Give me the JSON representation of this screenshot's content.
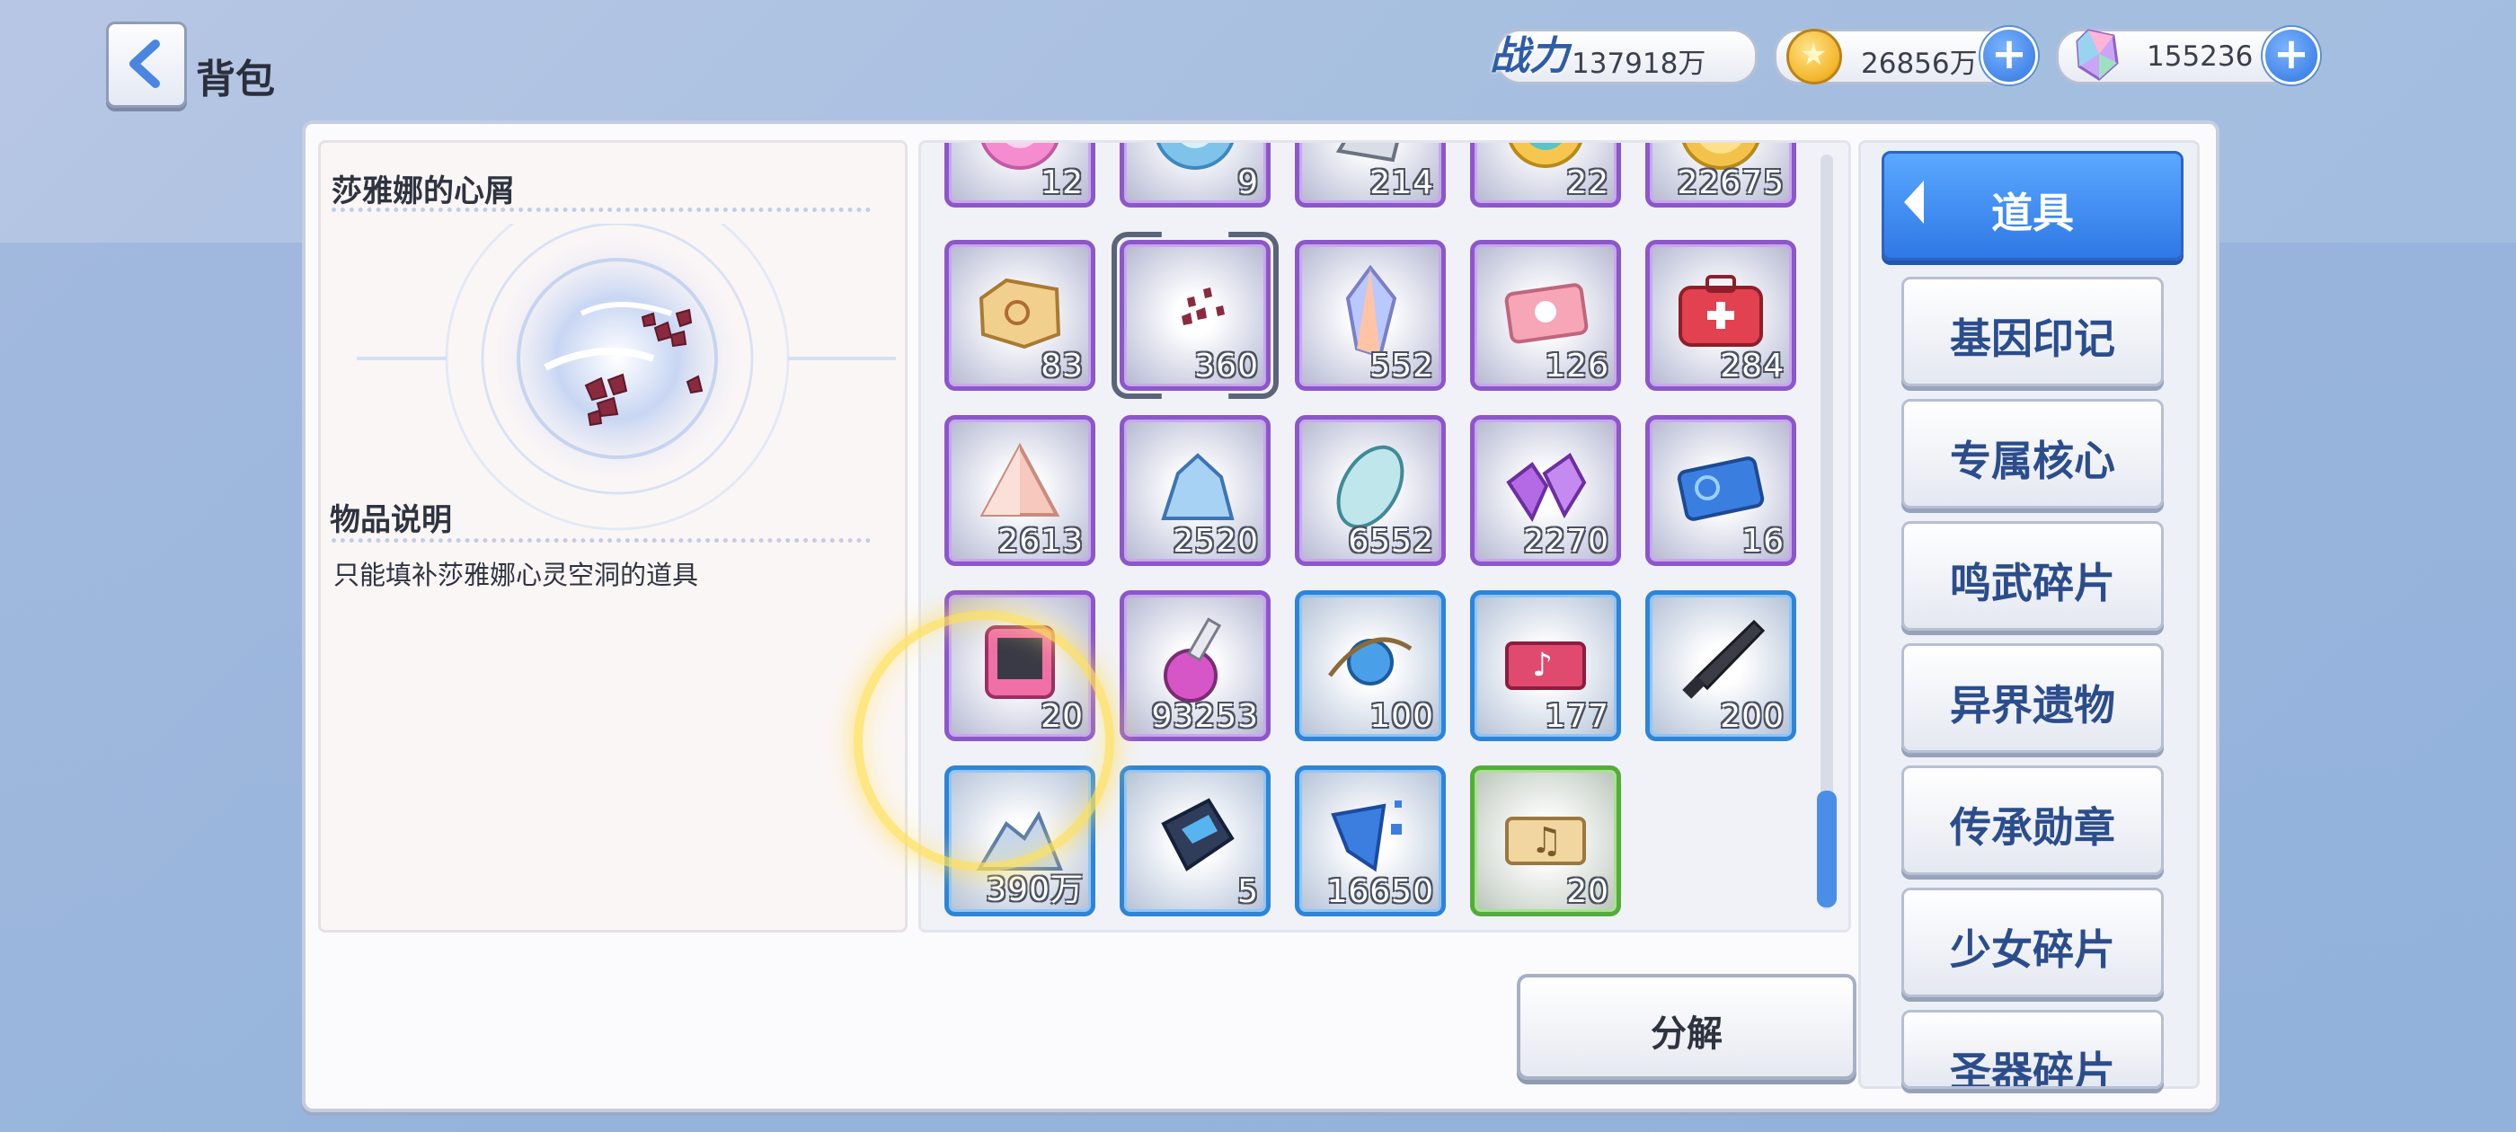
{
  "header": {
    "title": "背包",
    "power_label": "战力",
    "power_value": "137918万",
    "gold_value": "26856万",
    "gem_value": "155236"
  },
  "detail": {
    "item_name": "莎雅娜的心屑",
    "desc_title": "物品说明",
    "desc_text": "只能填补莎雅娜心灵空洞的道具"
  },
  "grid": {
    "rows": [
      [
        "12",
        "9",
        "214",
        "22",
        "22675"
      ],
      [
        "83",
        "360",
        "552",
        "126",
        "284"
      ],
      [
        "2613",
        "2520",
        "6552",
        "2270",
        "16"
      ],
      [
        "20",
        "93253",
        "100",
        "177",
        "200"
      ],
      [
        "390万",
        "5",
        "16650",
        "20"
      ]
    ]
  },
  "actions": {
    "decompose_label": "分解"
  },
  "categories": {
    "active": "道具",
    "items": [
      "基因印记",
      "专属核心",
      "鸣武碎片",
      "异界遗物",
      "传承勋章",
      "少女碎片",
      "圣器碎片"
    ]
  }
}
